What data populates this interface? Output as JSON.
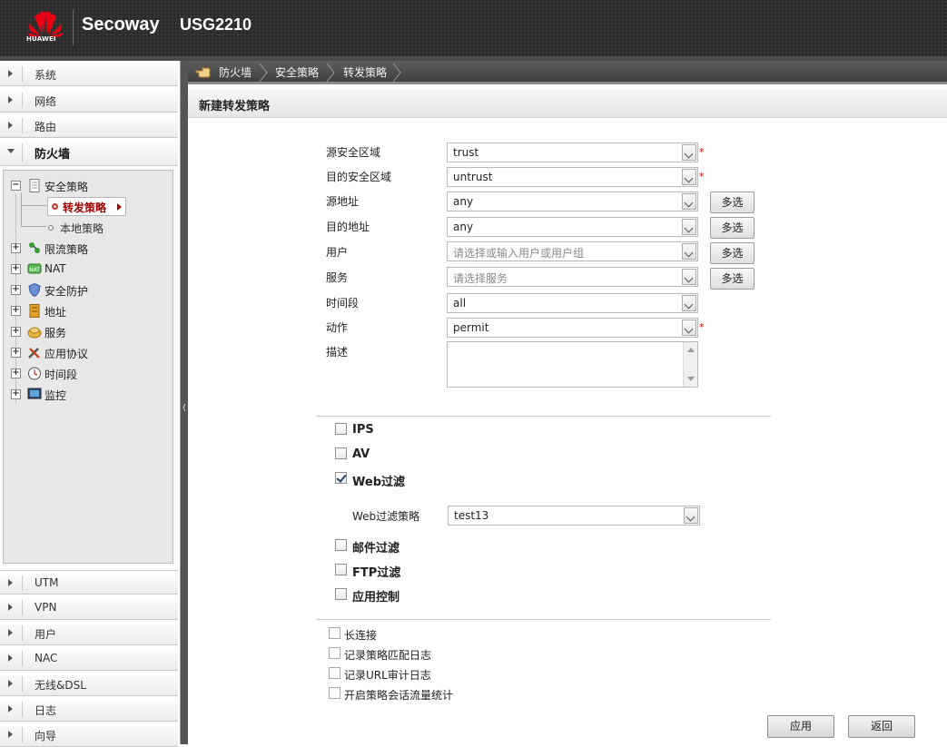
{
  "header": {
    "logo_text": "HUAWEI",
    "brand": "Secoway",
    "model": "USG2210"
  },
  "sidebar": {
    "top_items": [
      {
        "label": "系统"
      },
      {
        "label": "网络"
      },
      {
        "label": "路由"
      },
      {
        "label": "防火墙"
      }
    ],
    "tree": {
      "security_policy": "安全策略",
      "forward_policy": "转发策略",
      "local_policy": "本地策略",
      "items": [
        {
          "label": "限流策略",
          "icon": "traffic-limit-icon"
        },
        {
          "label": "NAT",
          "icon": "nat-icon"
        },
        {
          "label": "安全防护",
          "icon": "shield-icon"
        },
        {
          "label": "地址",
          "icon": "address-book-icon"
        },
        {
          "label": "服务",
          "icon": "service-icon"
        },
        {
          "label": "应用协议",
          "icon": "tools-icon"
        },
        {
          "label": "时间段",
          "icon": "clock-icon"
        },
        {
          "label": "监控",
          "icon": "monitor-icon"
        }
      ]
    },
    "bottom_items": [
      {
        "label": "UTM"
      },
      {
        "label": "VPN"
      },
      {
        "label": "用户"
      },
      {
        "label": "NAC"
      },
      {
        "label": "无线&DSL"
      },
      {
        "label": "日志"
      },
      {
        "label": "向导"
      }
    ]
  },
  "breadcrumb": [
    "防火墙",
    "安全策略",
    "转发策略"
  ],
  "page_title": "新建转发策略",
  "form": {
    "src_zone": {
      "label": "源安全区域",
      "value": "trust"
    },
    "dst_zone": {
      "label": "目的安全区域",
      "value": "untrust"
    },
    "src_addr": {
      "label": "源地址",
      "value": "any"
    },
    "dst_addr": {
      "label": "目的地址",
      "value": "any"
    },
    "user": {
      "label": "用户",
      "placeholder": "请选择或输入用户或用户组"
    },
    "service": {
      "label": "服务",
      "placeholder": "请选择服务"
    },
    "schedule": {
      "label": "时间段",
      "value": "all"
    },
    "action": {
      "label": "动作",
      "value": "permit"
    },
    "description": {
      "label": "描述",
      "value": ""
    },
    "multi_select_label": "多选",
    "required_mark": "*"
  },
  "utm": {
    "ips": {
      "label": "IPS",
      "checked": false
    },
    "av": {
      "label": "AV",
      "checked": false
    },
    "web_filter": {
      "label": "Web过滤",
      "checked": true
    },
    "web_filter_policy": {
      "label": "Web过滤策略",
      "value": "test13"
    },
    "mail_filter": {
      "label": "邮件过滤",
      "checked": false
    },
    "ftp_filter": {
      "label": "FTP过滤",
      "checked": false
    },
    "app_control": {
      "label": "应用控制",
      "checked": false
    }
  },
  "options": {
    "long_conn": "长连接",
    "log_match": "记录策略匹配日志",
    "log_url": "记录URL审计日志",
    "session_stats": "开启策略会话流量统计"
  },
  "buttons": {
    "apply": "应用",
    "back": "返回"
  }
}
